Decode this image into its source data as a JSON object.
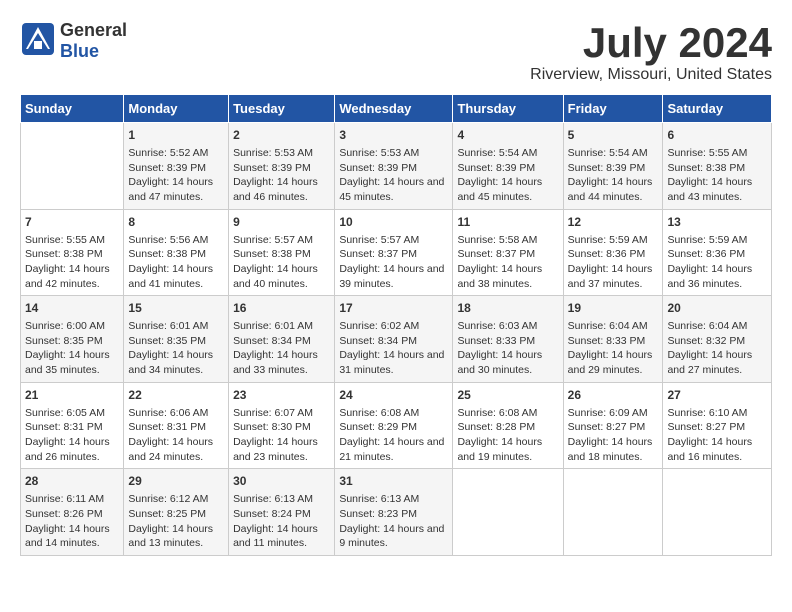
{
  "logo": {
    "general": "General",
    "blue": "Blue"
  },
  "title": "July 2024",
  "subtitle": "Riverview, Missouri, United States",
  "headers": [
    "Sunday",
    "Monday",
    "Tuesday",
    "Wednesday",
    "Thursday",
    "Friday",
    "Saturday"
  ],
  "weeks": [
    [
      {
        "day": "",
        "sunrise": "",
        "sunset": "",
        "daylight": ""
      },
      {
        "day": "1",
        "sunrise": "Sunrise: 5:52 AM",
        "sunset": "Sunset: 8:39 PM",
        "daylight": "Daylight: 14 hours and 47 minutes."
      },
      {
        "day": "2",
        "sunrise": "Sunrise: 5:53 AM",
        "sunset": "Sunset: 8:39 PM",
        "daylight": "Daylight: 14 hours and 46 minutes."
      },
      {
        "day": "3",
        "sunrise": "Sunrise: 5:53 AM",
        "sunset": "Sunset: 8:39 PM",
        "daylight": "Daylight: 14 hours and 45 minutes."
      },
      {
        "day": "4",
        "sunrise": "Sunrise: 5:54 AM",
        "sunset": "Sunset: 8:39 PM",
        "daylight": "Daylight: 14 hours and 45 minutes."
      },
      {
        "day": "5",
        "sunrise": "Sunrise: 5:54 AM",
        "sunset": "Sunset: 8:39 PM",
        "daylight": "Daylight: 14 hours and 44 minutes."
      },
      {
        "day": "6",
        "sunrise": "Sunrise: 5:55 AM",
        "sunset": "Sunset: 8:38 PM",
        "daylight": "Daylight: 14 hours and 43 minutes."
      }
    ],
    [
      {
        "day": "7",
        "sunrise": "Sunrise: 5:55 AM",
        "sunset": "Sunset: 8:38 PM",
        "daylight": "Daylight: 14 hours and 42 minutes."
      },
      {
        "day": "8",
        "sunrise": "Sunrise: 5:56 AM",
        "sunset": "Sunset: 8:38 PM",
        "daylight": "Daylight: 14 hours and 41 minutes."
      },
      {
        "day": "9",
        "sunrise": "Sunrise: 5:57 AM",
        "sunset": "Sunset: 8:38 PM",
        "daylight": "Daylight: 14 hours and 40 minutes."
      },
      {
        "day": "10",
        "sunrise": "Sunrise: 5:57 AM",
        "sunset": "Sunset: 8:37 PM",
        "daylight": "Daylight: 14 hours and 39 minutes."
      },
      {
        "day": "11",
        "sunrise": "Sunrise: 5:58 AM",
        "sunset": "Sunset: 8:37 PM",
        "daylight": "Daylight: 14 hours and 38 minutes."
      },
      {
        "day": "12",
        "sunrise": "Sunrise: 5:59 AM",
        "sunset": "Sunset: 8:36 PM",
        "daylight": "Daylight: 14 hours and 37 minutes."
      },
      {
        "day": "13",
        "sunrise": "Sunrise: 5:59 AM",
        "sunset": "Sunset: 8:36 PM",
        "daylight": "Daylight: 14 hours and 36 minutes."
      }
    ],
    [
      {
        "day": "14",
        "sunrise": "Sunrise: 6:00 AM",
        "sunset": "Sunset: 8:35 PM",
        "daylight": "Daylight: 14 hours and 35 minutes."
      },
      {
        "day": "15",
        "sunrise": "Sunrise: 6:01 AM",
        "sunset": "Sunset: 8:35 PM",
        "daylight": "Daylight: 14 hours and 34 minutes."
      },
      {
        "day": "16",
        "sunrise": "Sunrise: 6:01 AM",
        "sunset": "Sunset: 8:34 PM",
        "daylight": "Daylight: 14 hours and 33 minutes."
      },
      {
        "day": "17",
        "sunrise": "Sunrise: 6:02 AM",
        "sunset": "Sunset: 8:34 PM",
        "daylight": "Daylight: 14 hours and 31 minutes."
      },
      {
        "day": "18",
        "sunrise": "Sunrise: 6:03 AM",
        "sunset": "Sunset: 8:33 PM",
        "daylight": "Daylight: 14 hours and 30 minutes."
      },
      {
        "day": "19",
        "sunrise": "Sunrise: 6:04 AM",
        "sunset": "Sunset: 8:33 PM",
        "daylight": "Daylight: 14 hours and 29 minutes."
      },
      {
        "day": "20",
        "sunrise": "Sunrise: 6:04 AM",
        "sunset": "Sunset: 8:32 PM",
        "daylight": "Daylight: 14 hours and 27 minutes."
      }
    ],
    [
      {
        "day": "21",
        "sunrise": "Sunrise: 6:05 AM",
        "sunset": "Sunset: 8:31 PM",
        "daylight": "Daylight: 14 hours and 26 minutes."
      },
      {
        "day": "22",
        "sunrise": "Sunrise: 6:06 AM",
        "sunset": "Sunset: 8:31 PM",
        "daylight": "Daylight: 14 hours and 24 minutes."
      },
      {
        "day": "23",
        "sunrise": "Sunrise: 6:07 AM",
        "sunset": "Sunset: 8:30 PM",
        "daylight": "Daylight: 14 hours and 23 minutes."
      },
      {
        "day": "24",
        "sunrise": "Sunrise: 6:08 AM",
        "sunset": "Sunset: 8:29 PM",
        "daylight": "Daylight: 14 hours and 21 minutes."
      },
      {
        "day": "25",
        "sunrise": "Sunrise: 6:08 AM",
        "sunset": "Sunset: 8:28 PM",
        "daylight": "Daylight: 14 hours and 19 minutes."
      },
      {
        "day": "26",
        "sunrise": "Sunrise: 6:09 AM",
        "sunset": "Sunset: 8:27 PM",
        "daylight": "Daylight: 14 hours and 18 minutes."
      },
      {
        "day": "27",
        "sunrise": "Sunrise: 6:10 AM",
        "sunset": "Sunset: 8:27 PM",
        "daylight": "Daylight: 14 hours and 16 minutes."
      }
    ],
    [
      {
        "day": "28",
        "sunrise": "Sunrise: 6:11 AM",
        "sunset": "Sunset: 8:26 PM",
        "daylight": "Daylight: 14 hours and 14 minutes."
      },
      {
        "day": "29",
        "sunrise": "Sunrise: 6:12 AM",
        "sunset": "Sunset: 8:25 PM",
        "daylight": "Daylight: 14 hours and 13 minutes."
      },
      {
        "day": "30",
        "sunrise": "Sunrise: 6:13 AM",
        "sunset": "Sunset: 8:24 PM",
        "daylight": "Daylight: 14 hours and 11 minutes."
      },
      {
        "day": "31",
        "sunrise": "Sunrise: 6:13 AM",
        "sunset": "Sunset: 8:23 PM",
        "daylight": "Daylight: 14 hours and 9 minutes."
      },
      {
        "day": "",
        "sunrise": "",
        "sunset": "",
        "daylight": ""
      },
      {
        "day": "",
        "sunrise": "",
        "sunset": "",
        "daylight": ""
      },
      {
        "day": "",
        "sunrise": "",
        "sunset": "",
        "daylight": ""
      }
    ]
  ]
}
